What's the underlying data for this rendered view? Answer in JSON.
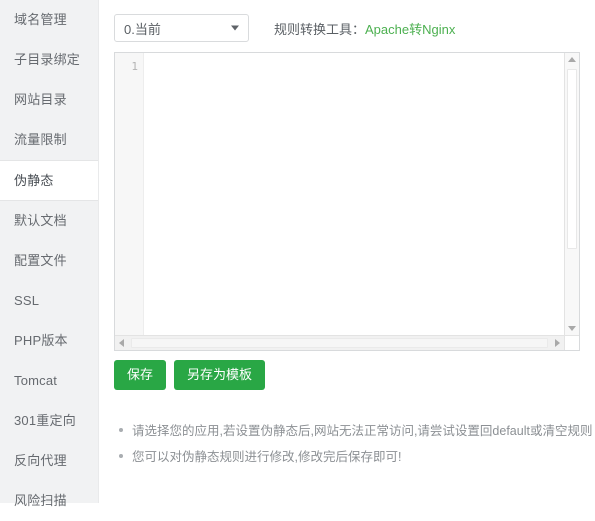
{
  "sidebar": {
    "items": [
      {
        "label": "域名管理",
        "active": false
      },
      {
        "label": "子目录绑定",
        "active": false
      },
      {
        "label": "网站目录",
        "active": false
      },
      {
        "label": "流量限制",
        "active": false
      },
      {
        "label": "伪静态",
        "active": true
      },
      {
        "label": "默认文档",
        "active": false
      },
      {
        "label": "配置文件",
        "active": false
      },
      {
        "label": "SSL",
        "active": false
      },
      {
        "label": "PHP版本",
        "active": false
      },
      {
        "label": "Tomcat",
        "active": false
      },
      {
        "label": "301重定向",
        "active": false
      },
      {
        "label": "反向代理",
        "active": false
      },
      {
        "label": "风险扫描",
        "active": false
      }
    ]
  },
  "toolbar": {
    "select": {
      "value": "0.当前",
      "caret_icon": "chevron-down-icon"
    },
    "converter_label": "规则转换工具：",
    "converter_link": "Apache转Nginx",
    "link_color": "#4cb050"
  },
  "editor": {
    "line_numbers": [
      "1"
    ],
    "content": "",
    "placeholder": "",
    "vertical_scrollbar": {
      "up_icon": "arrow-up-icon",
      "down_icon": "arrow-down-icon"
    },
    "horizontal_scrollbar": {
      "left_icon": "arrow-left-icon",
      "right_icon": "arrow-right-icon"
    }
  },
  "buttons": {
    "save_label": "保存",
    "save_as_template_label": "另存为模板",
    "color": "#29a745"
  },
  "notes": [
    "请选择您的应用,若设置伪静态后,网站无法正常访问,请尝试设置回default或清空规则",
    "您可以对伪静态规则进行修改,修改完后保存即可!"
  ]
}
